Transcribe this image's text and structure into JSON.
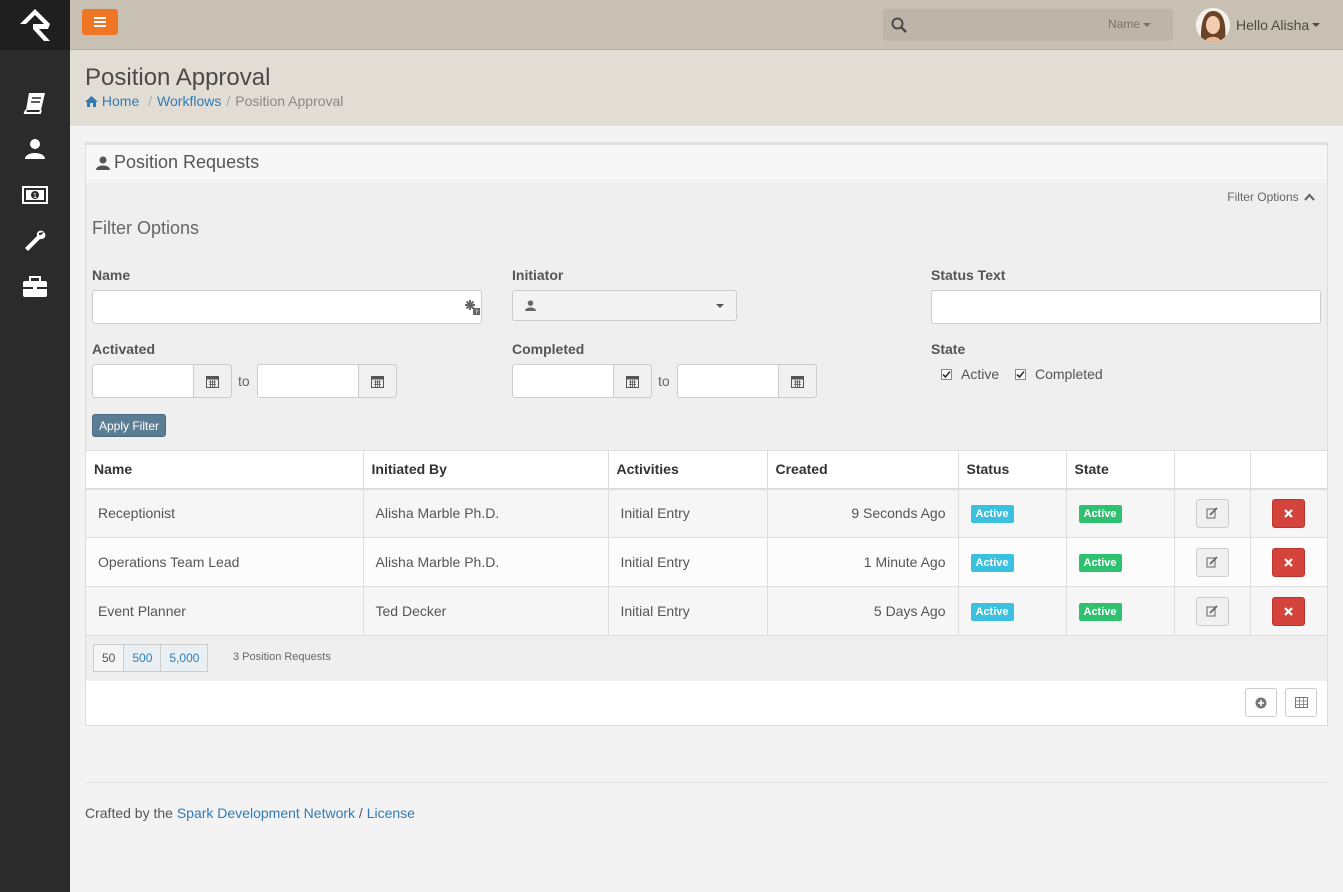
{
  "header": {
    "search_filter": "Name",
    "user_greeting": "Hello Alisha"
  },
  "sidebar": {
    "icons": [
      "book-icon",
      "person-icon",
      "money-icon",
      "wrench-icon",
      "briefcase-icon"
    ]
  },
  "page": {
    "title": "Position Approval",
    "breadcrumb": [
      "Home",
      "Workflows",
      "Position Approval"
    ]
  },
  "panel": {
    "title": "Position Requests",
    "filter_toggle": "Filter Options",
    "filter_title": "Filter Options"
  },
  "filters": {
    "name_label": "Name",
    "name_value": "",
    "initiator_label": "Initiator",
    "status_text_label": "Status Text",
    "status_text_value": "",
    "activated_label": "Activated",
    "completed_label": "Completed",
    "to_label": "to",
    "state_label": "State",
    "state_options": [
      {
        "label": "Active",
        "checked": true
      },
      {
        "label": "Completed",
        "checked": true
      }
    ],
    "apply_label": "Apply Filter"
  },
  "table": {
    "columns": [
      "Name",
      "Initiated By",
      "Activities",
      "Created",
      "Status",
      "State",
      "",
      ""
    ],
    "rows": [
      {
        "name": "Receptionist",
        "initiated_by": "Alisha Marble Ph.D.",
        "activities": "Initial Entry",
        "created": "9 Seconds Ago",
        "status": "Active",
        "state": "Active"
      },
      {
        "name": "Operations Team Lead",
        "initiated_by": "Alisha Marble Ph.D.",
        "activities": "Initial Entry",
        "created": "1 Minute Ago",
        "status": "Active",
        "state": "Active"
      },
      {
        "name": "Event Planner",
        "initiated_by": "Ted Decker",
        "activities": "Initial Entry",
        "created": "5 Days Ago",
        "status": "Active",
        "state": "Active"
      }
    ],
    "page_sizes": [
      "50",
      "500",
      "5,000"
    ],
    "count_text": "3 Position Requests"
  },
  "footer": {
    "prefix": "Crafted by the",
    "link1": "Spark Development Network",
    "separator": "/",
    "link2": "License"
  },
  "colors": {
    "accent": "#ee7624",
    "info": "#3bc1e0",
    "success": "#2ec270",
    "danger": "#d4443c"
  }
}
